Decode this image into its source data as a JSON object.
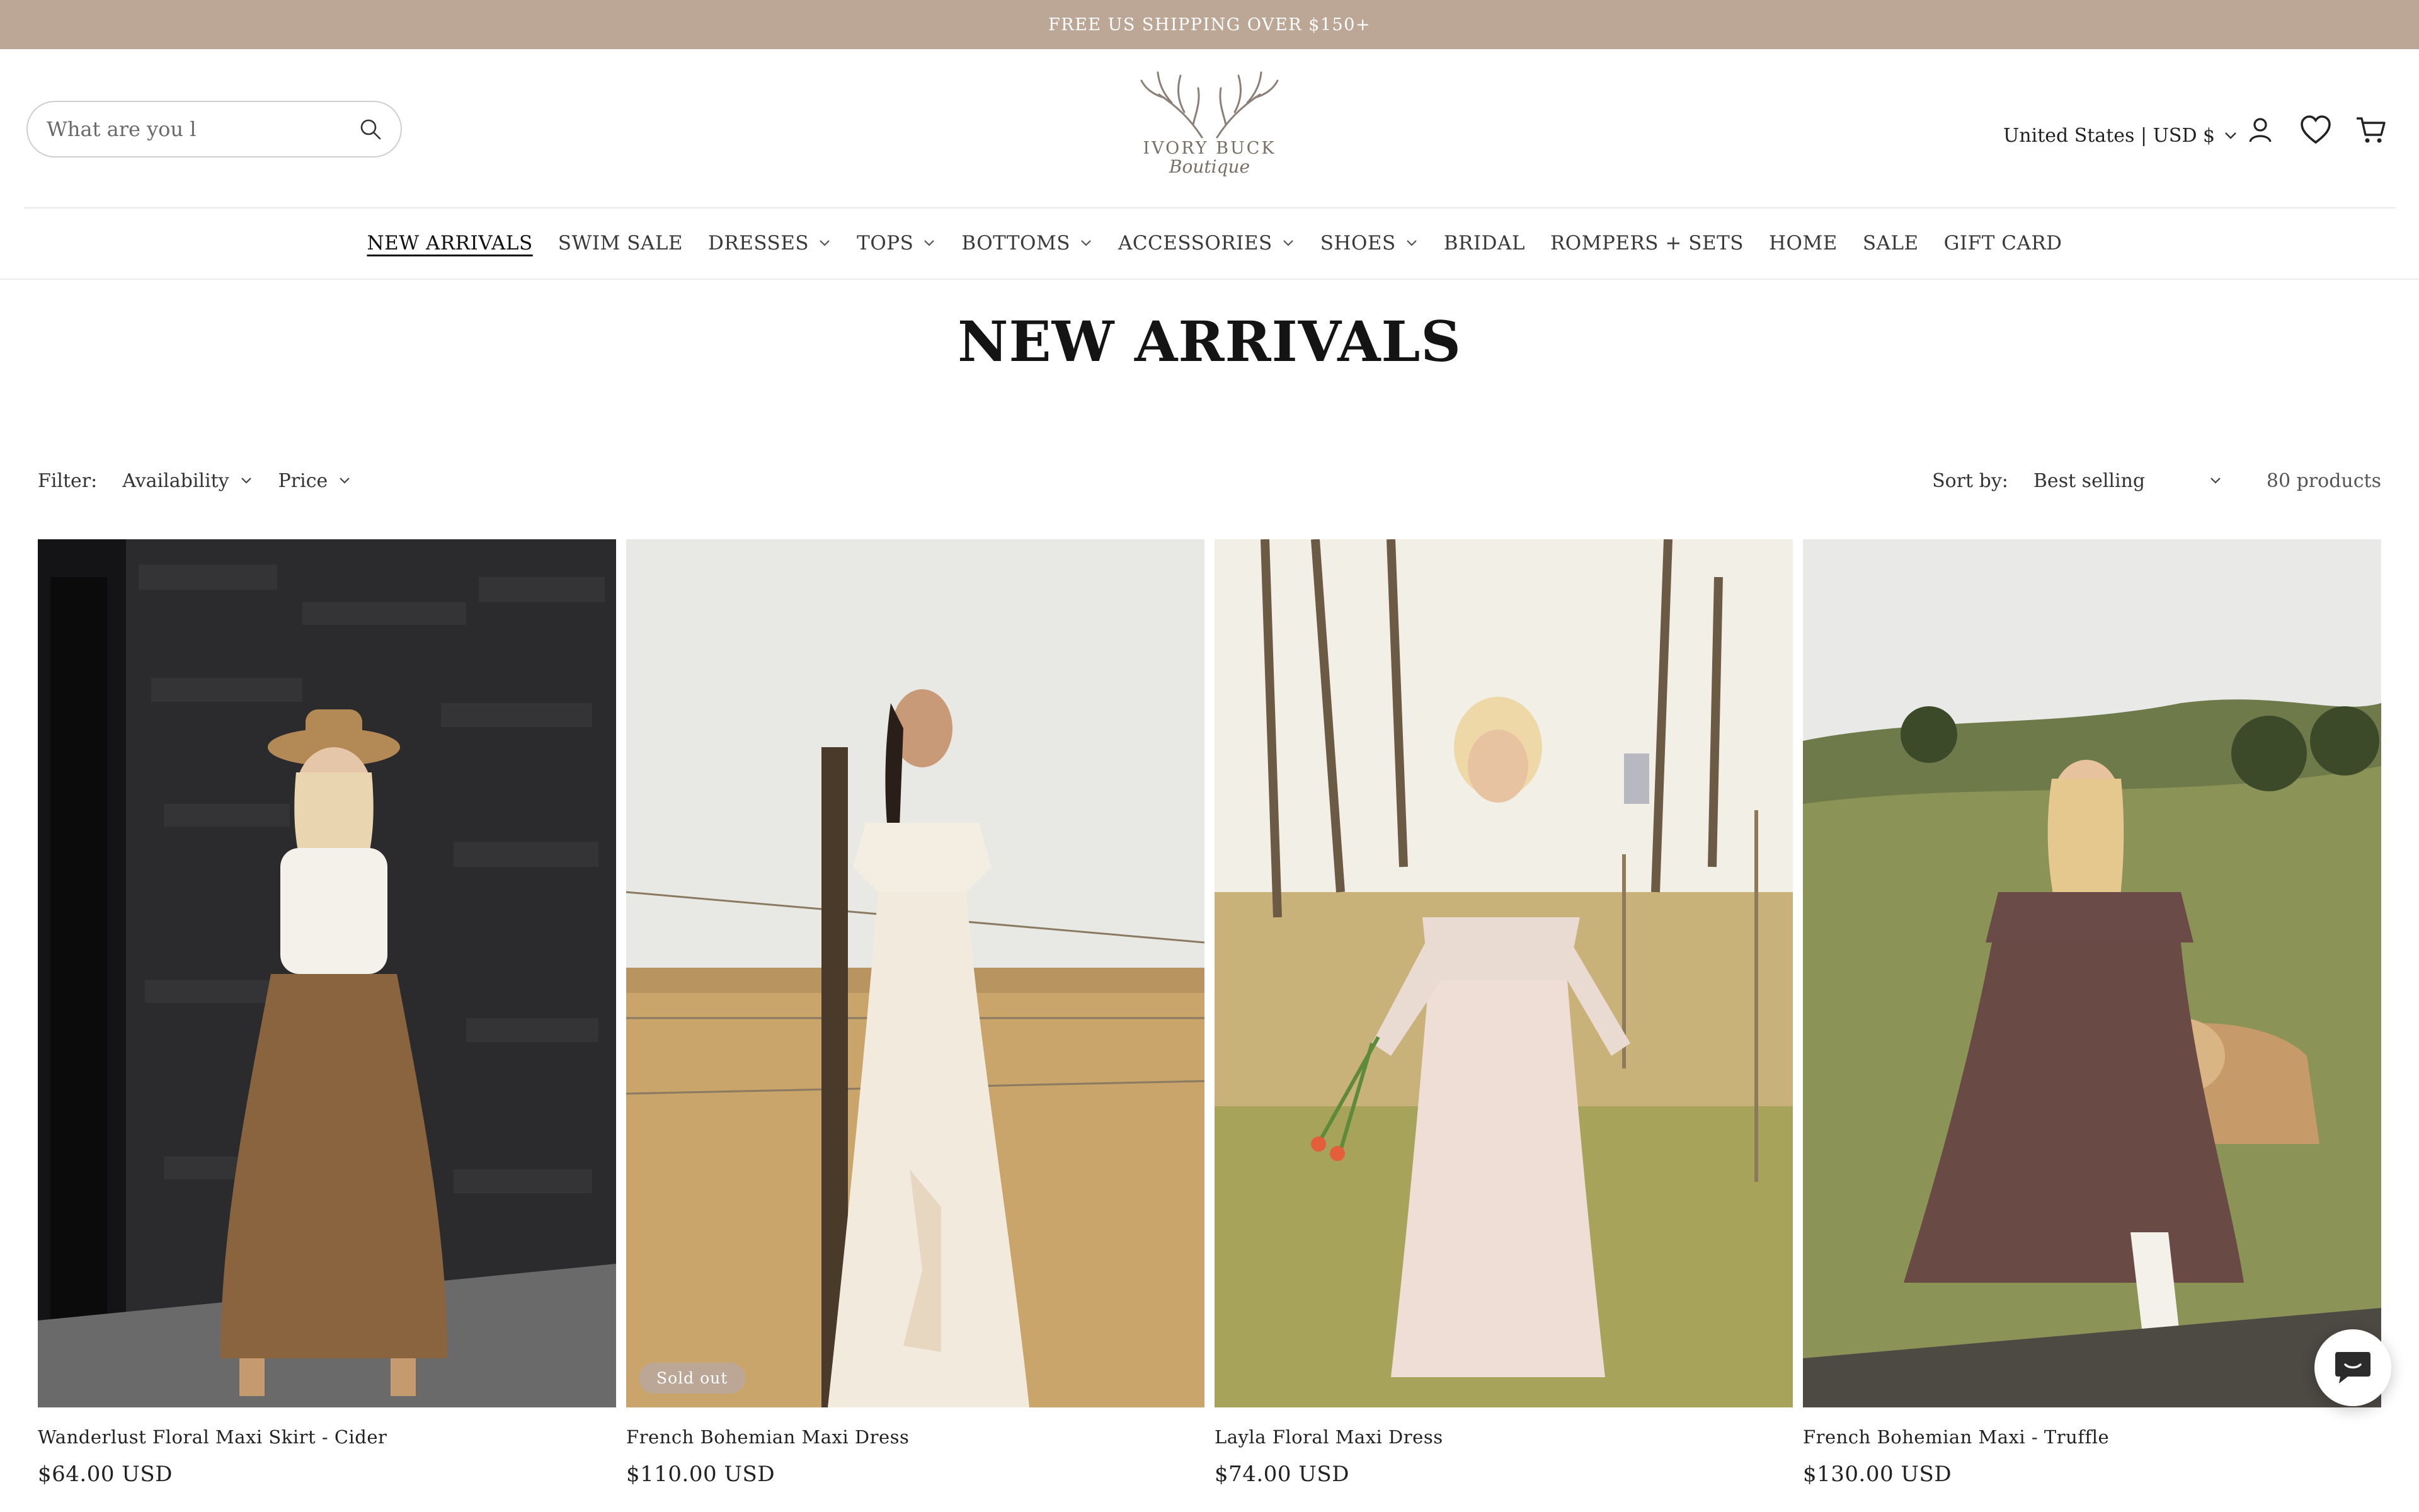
{
  "announcement": "FREE US SHIPPING OVER $150+",
  "search": {
    "placeholder": "What are you l"
  },
  "logo": {
    "name": "IVORY BUCK",
    "script": "Boutique"
  },
  "country_selector": "United States | USD $",
  "nav": [
    {
      "label": "NEW ARRIVALS",
      "dropdown": false,
      "active": true
    },
    {
      "label": "SWIM SALE",
      "dropdown": false
    },
    {
      "label": "DRESSES",
      "dropdown": true
    },
    {
      "label": "TOPS",
      "dropdown": true
    },
    {
      "label": "BOTTOMS",
      "dropdown": true
    },
    {
      "label": "ACCESSORIES",
      "dropdown": true
    },
    {
      "label": "SHOES",
      "dropdown": true
    },
    {
      "label": "BRIDAL",
      "dropdown": false
    },
    {
      "label": "ROMPERS + SETS",
      "dropdown": false
    },
    {
      "label": "HOME",
      "dropdown": false
    },
    {
      "label": "SALE",
      "dropdown": false
    },
    {
      "label": "GIFT CARD",
      "dropdown": false
    }
  ],
  "page_title": "NEW ARRIVALS",
  "filters": {
    "label": "Filter:",
    "availability": "Availability",
    "price": "Price",
    "sort_label": "Sort by:",
    "sort_value": "Best selling",
    "count": "80 products"
  },
  "products": [
    {
      "name": "Wanderlust Floral Maxi Skirt - Cider",
      "price": "$64.00 USD",
      "badge": ""
    },
    {
      "name": "French Bohemian Maxi Dress",
      "price": "$110.00 USD",
      "badge": "Sold out"
    },
    {
      "name": "Layla Floral Maxi Dress",
      "price": "$74.00 USD",
      "badge": ""
    },
    {
      "name": "French Bohemian Maxi - Truffle",
      "price": "$130.00 USD",
      "badge": ""
    }
  ],
  "colors": {
    "announcement_bg": "#bca797",
    "text": "#1e1e1e",
    "badge_bg": "#bca797"
  }
}
